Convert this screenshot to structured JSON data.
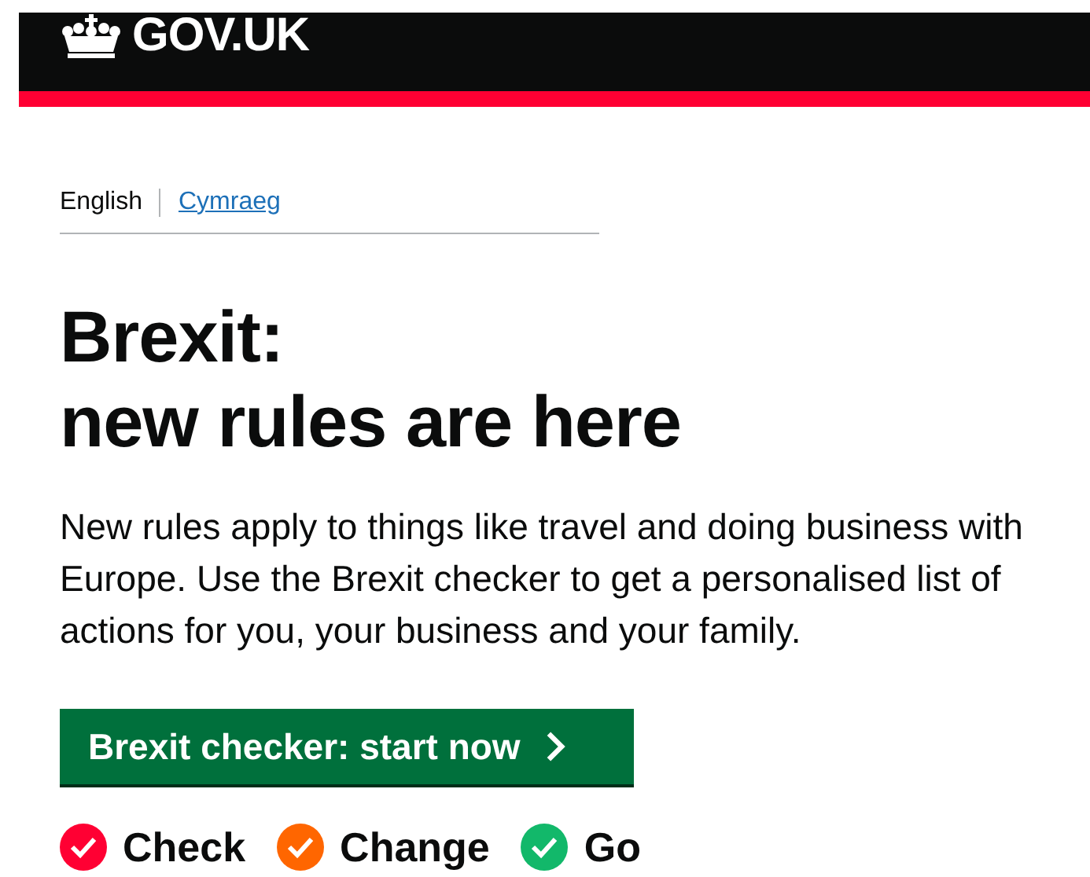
{
  "header": {
    "logo": "GOV.UK"
  },
  "language_switch": [
    {
      "label": "English",
      "selected": true
    },
    {
      "label": "Cymraeg",
      "selected": false
    }
  ],
  "heading": {
    "lines": [
      "Brexit:",
      "new rules are here"
    ]
  },
  "intro": "New rules apply to things like travel and doing business with Europe. Use the Brexit checker to get a personalised list of actions for you, your business and your family.",
  "start_button": {
    "label": "Brexit checker: start now"
  },
  "steps": [
    {
      "label": "Check",
      "color": "#ff0033"
    },
    {
      "label": "Change",
      "color": "#ff6600"
    },
    {
      "label": "Go",
      "color": "#12b86a"
    }
  ]
}
